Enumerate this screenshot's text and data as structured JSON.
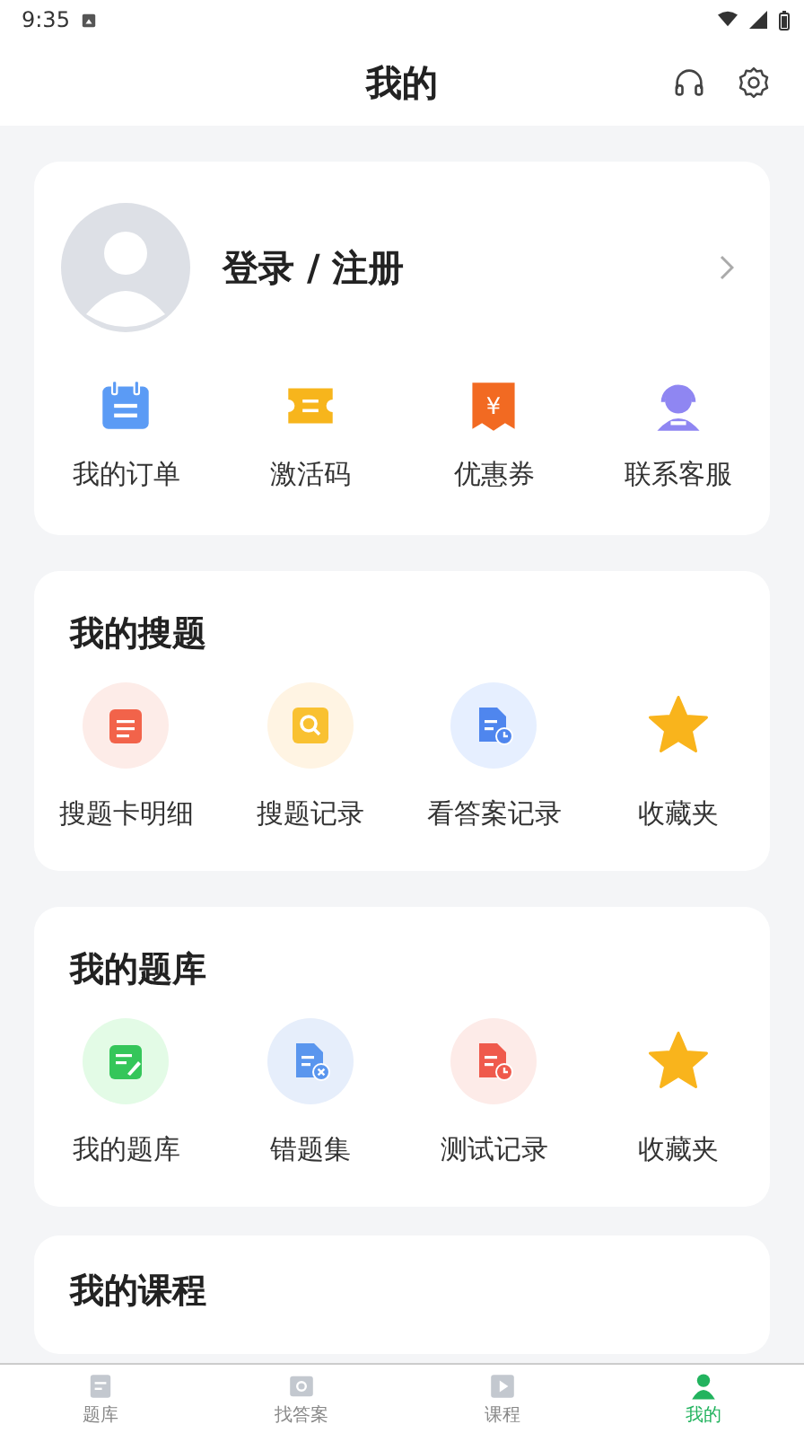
{
  "status_bar": {
    "time": "9:35"
  },
  "header": {
    "title": "我的"
  },
  "profile": {
    "login": "登录 / 注册"
  },
  "shortcuts": [
    {
      "label": "我的订单",
      "kind": "calendar"
    },
    {
      "label": "激活码",
      "kind": "ticket"
    },
    {
      "label": "优惠券",
      "kind": "coupon",
      "glyph": "¥"
    },
    {
      "label": "联系客服",
      "kind": "agent"
    }
  ],
  "sections": [
    {
      "title": "我的搜题",
      "items": [
        {
          "label": "搜题卡明细",
          "kind": "notes"
        },
        {
          "label": "搜题记录",
          "kind": "search"
        },
        {
          "label": "看答案记录",
          "kind": "doc-clock"
        },
        {
          "label": "收藏夹",
          "kind": "star"
        }
      ]
    },
    {
      "title": "我的题库",
      "items": [
        {
          "label": "我的题库",
          "kind": "edit"
        },
        {
          "label": "错题集",
          "kind": "doc-x"
        },
        {
          "label": "测试记录",
          "kind": "doc-clock-red"
        },
        {
          "label": "收藏夹",
          "kind": "star"
        }
      ]
    },
    {
      "title": "我的课程"
    }
  ],
  "bottom_nav": [
    {
      "label": "题库",
      "kind": "doc",
      "selected": false
    },
    {
      "label": "找答案",
      "kind": "search",
      "selected": false
    },
    {
      "label": "课程",
      "kind": "play",
      "selected": false
    },
    {
      "label": "我的",
      "kind": "person",
      "selected": true
    }
  ]
}
